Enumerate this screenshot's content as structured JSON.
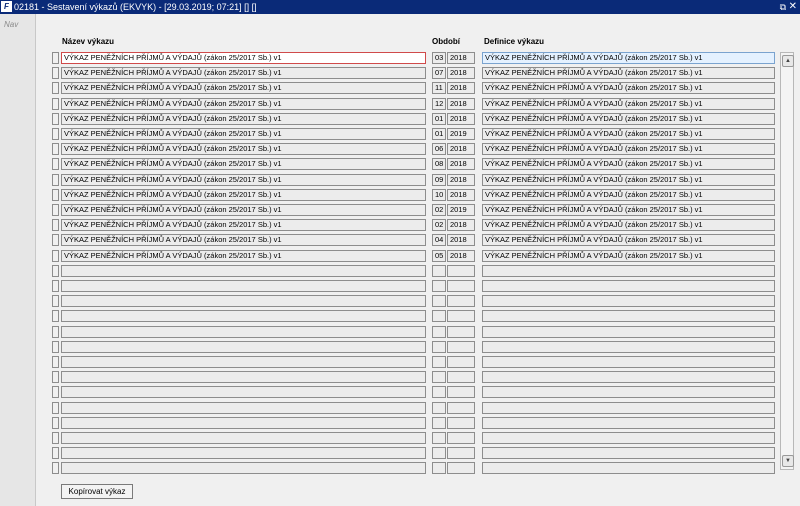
{
  "window": {
    "title": "02181 - Sestavení výkazů (EKVYK) - [29.03.2019; 07:21] [] []",
    "app_icon": "F",
    "restore": "⧉",
    "close": "✕"
  },
  "sidebar": {
    "nav_label": "Nav"
  },
  "table": {
    "headers": {
      "name": "Název výkazu",
      "period": "Období",
      "definition": "Definice výkazu"
    },
    "rows": [
      {
        "name": "VÝKAZ PENĚŽNÍCH PŘÍJMŮ A VÝDAJŮ (zákon 25/2017 Sb.) v1",
        "month": "03",
        "year": "2018",
        "definition": "VÝKAZ PENĚŽNÍCH PŘÍJMŮ A VÝDAJŮ (zákon 25/2017 Sb.) v1"
      },
      {
        "name": "VÝKAZ PENĚŽNÍCH PŘÍJMŮ A VÝDAJŮ (zákon 25/2017 Sb.) v1",
        "month": "07",
        "year": "2018",
        "definition": "VÝKAZ PENĚŽNÍCH PŘÍJMŮ A VÝDAJŮ (zákon 25/2017 Sb.) v1"
      },
      {
        "name": "VÝKAZ PENĚŽNÍCH PŘÍJMŮ A VÝDAJŮ (zákon 25/2017 Sb.) v1",
        "month": "11",
        "year": "2018",
        "definition": "VÝKAZ PENĚŽNÍCH PŘÍJMŮ A VÝDAJŮ (zákon 25/2017 Sb.) v1"
      },
      {
        "name": "VÝKAZ PENĚŽNÍCH PŘÍJMŮ A VÝDAJŮ (zákon 25/2017 Sb.) v1",
        "month": "12",
        "year": "2018",
        "definition": "VÝKAZ PENĚŽNÍCH PŘÍJMŮ A VÝDAJŮ (zákon 25/2017 Sb.) v1"
      },
      {
        "name": "VÝKAZ PENĚŽNÍCH PŘÍJMŮ A VÝDAJŮ (zákon 25/2017 Sb.) v1",
        "month": "01",
        "year": "2018",
        "definition": "VÝKAZ PENĚŽNÍCH PŘÍJMŮ A VÝDAJŮ (zákon 25/2017 Sb.) v1"
      },
      {
        "name": "VÝKAZ PENĚŽNÍCH PŘÍJMŮ A VÝDAJŮ (zákon 25/2017 Sb.) v1",
        "month": "01",
        "year": "2019",
        "definition": "VÝKAZ PENĚŽNÍCH PŘÍJMŮ A VÝDAJŮ (zákon 25/2017 Sb.) v1"
      },
      {
        "name": "VÝKAZ PENĚŽNÍCH PŘÍJMŮ A VÝDAJŮ (zákon 25/2017 Sb.) v1",
        "month": "06",
        "year": "2018",
        "definition": "VÝKAZ PENĚŽNÍCH PŘÍJMŮ A VÝDAJŮ (zákon 25/2017 Sb.) v1"
      },
      {
        "name": "VÝKAZ PENĚŽNÍCH PŘÍJMŮ A VÝDAJŮ (zákon 25/2017 Sb.) v1",
        "month": "08",
        "year": "2018",
        "definition": "VÝKAZ PENĚŽNÍCH PŘÍJMŮ A VÝDAJŮ (zákon 25/2017 Sb.) v1"
      },
      {
        "name": "VÝKAZ PENĚŽNÍCH PŘÍJMŮ A VÝDAJŮ (zákon 25/2017 Sb.) v1",
        "month": "09",
        "year": "2018",
        "definition": "VÝKAZ PENĚŽNÍCH PŘÍJMŮ A VÝDAJŮ (zákon 25/2017 Sb.) v1"
      },
      {
        "name": "VÝKAZ PENĚŽNÍCH PŘÍJMŮ A VÝDAJŮ (zákon 25/2017 Sb.) v1",
        "month": "10",
        "year": "2018",
        "definition": "VÝKAZ PENĚŽNÍCH PŘÍJMŮ A VÝDAJŮ (zákon 25/2017 Sb.) v1"
      },
      {
        "name": "VÝKAZ PENĚŽNÍCH PŘÍJMŮ A VÝDAJŮ (zákon 25/2017 Sb.) v1",
        "month": "02",
        "year": "2019",
        "definition": "VÝKAZ PENĚŽNÍCH PŘÍJMŮ A VÝDAJŮ (zákon 25/2017 Sb.) v1"
      },
      {
        "name": "VÝKAZ PENĚŽNÍCH PŘÍJMŮ A VÝDAJŮ (zákon 25/2017 Sb.) v1",
        "month": "02",
        "year": "2018",
        "definition": "VÝKAZ PENĚŽNÍCH PŘÍJMŮ A VÝDAJŮ (zákon 25/2017 Sb.) v1"
      },
      {
        "name": "VÝKAZ PENĚŽNÍCH PŘÍJMŮ A VÝDAJŮ (zákon 25/2017 Sb.) v1",
        "month": "04",
        "year": "2018",
        "definition": "VÝKAZ PENĚŽNÍCH PŘÍJMŮ A VÝDAJŮ (zákon 25/2017 Sb.) v1"
      },
      {
        "name": "VÝKAZ PENĚŽNÍCH PŘÍJMŮ A VÝDAJŮ (zákon 25/2017 Sb.) v1",
        "month": "05",
        "year": "2018",
        "definition": "VÝKAZ PENĚŽNÍCH PŘÍJMŮ A VÝDAJŮ (zákon 25/2017 Sb.) v1"
      },
      {
        "name": "",
        "month": "",
        "year": "",
        "definition": ""
      },
      {
        "name": "",
        "month": "",
        "year": "",
        "definition": ""
      },
      {
        "name": "",
        "month": "",
        "year": "",
        "definition": ""
      },
      {
        "name": "",
        "month": "",
        "year": "",
        "definition": ""
      },
      {
        "name": "",
        "month": "",
        "year": "",
        "definition": ""
      },
      {
        "name": "",
        "month": "",
        "year": "",
        "definition": ""
      },
      {
        "name": "",
        "month": "",
        "year": "",
        "definition": ""
      },
      {
        "name": "",
        "month": "",
        "year": "",
        "definition": ""
      },
      {
        "name": "",
        "month": "",
        "year": "",
        "definition": ""
      },
      {
        "name": "",
        "month": "",
        "year": "",
        "definition": ""
      },
      {
        "name": "",
        "month": "",
        "year": "",
        "definition": ""
      },
      {
        "name": "",
        "month": "",
        "year": "",
        "definition": ""
      },
      {
        "name": "",
        "month": "",
        "year": "",
        "definition": ""
      },
      {
        "name": "",
        "month": "",
        "year": "",
        "definition": ""
      }
    ]
  },
  "scrollbar": {
    "up": "▲",
    "down": "▼"
  },
  "buttons": {
    "copy": "Kopírovat výkaz"
  }
}
